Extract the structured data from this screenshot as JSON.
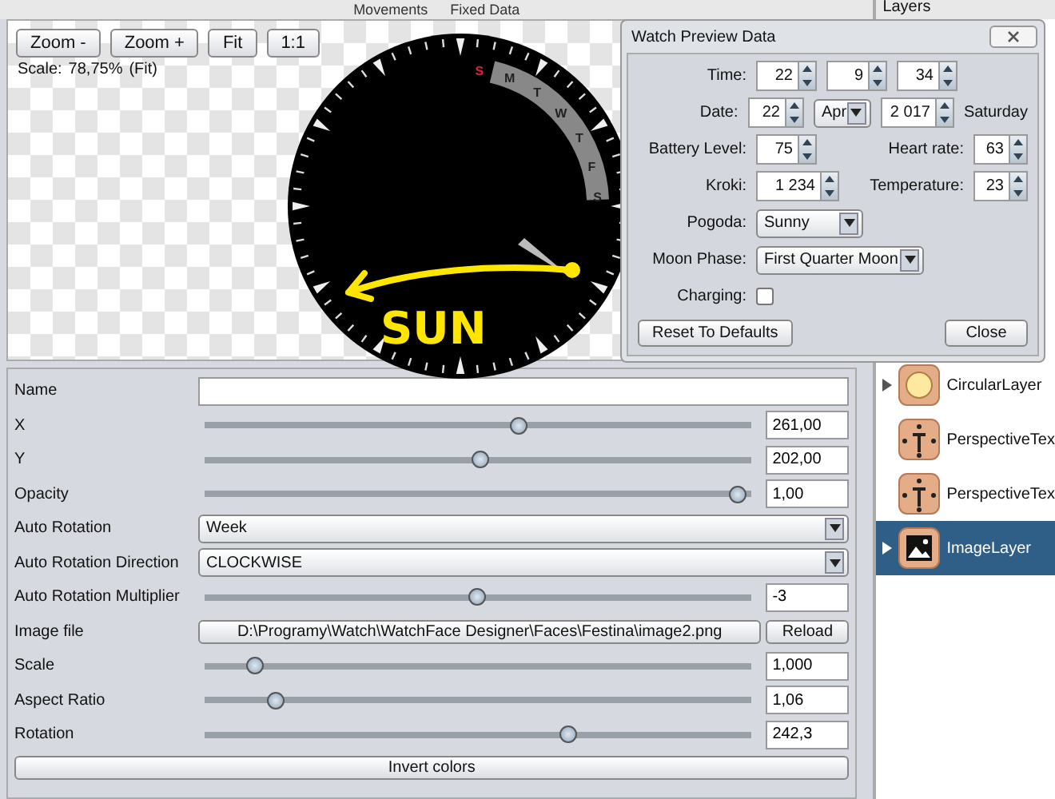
{
  "header": {
    "tabs": [
      "Movements",
      "Fixed Data"
    ]
  },
  "preview": {
    "buttons": [
      "Zoom -",
      "Zoom +",
      "Fit",
      "1:1"
    ],
    "scale_label": "Scale:",
    "scale_value": "78,75%",
    "scale_mode": "(Fit)",
    "dial_days": [
      "S",
      "M",
      "T",
      "W",
      "T",
      "F",
      "S"
    ],
    "annotation": "SUN"
  },
  "properties": [
    {
      "kind": "text",
      "label": "Name"
    },
    {
      "kind": "slider",
      "label": "X",
      "level": 0.577,
      "value": "261,00"
    },
    {
      "kind": "slider",
      "label": "Y",
      "level": 0.505,
      "value": "202,00"
    },
    {
      "kind": "slider",
      "label": "Opacity",
      "level": 0.99,
      "value": "1,00"
    },
    {
      "kind": "select",
      "label": "Auto Rotation",
      "value": "Week"
    },
    {
      "kind": "select",
      "label": "Auto Rotation Direction",
      "value": "CLOCKWISE"
    },
    {
      "kind": "slider",
      "label": "Auto Rotation Multiplier",
      "level": 0.497,
      "value": "-3"
    },
    {
      "kind": "file",
      "label": "Image file",
      "value": "D:\\Programy\\Watch\\WatchFace Designer\\Faces\\Festina\\image2.png",
      "action": "Reload"
    },
    {
      "kind": "slider",
      "label": "Scale",
      "level": 0.079,
      "value": "1,000"
    },
    {
      "kind": "slider",
      "label": "Aspect Ratio",
      "level": 0.117,
      "value": "1,06"
    },
    {
      "kind": "slider",
      "label": "Rotation",
      "level": 0.67,
      "value": "242,3"
    }
  ],
  "invert_button": "Invert colors",
  "layers": {
    "title": "Layers",
    "items": [
      {
        "name": "CircularLayer",
        "kind": "circle",
        "expandable": true,
        "selected": false
      },
      {
        "name": "PerspectiveTex",
        "kind": "text",
        "expandable": false,
        "selected": false
      },
      {
        "name": "PerspectiveTex",
        "kind": "text",
        "expandable": false,
        "selected": false
      },
      {
        "name": "ImageLayer",
        "kind": "image",
        "expandable": true,
        "selected": true
      }
    ]
  },
  "dialog": {
    "title": "Watch Preview Data",
    "time_label": "Time:",
    "time": [
      "22",
      "9",
      "34"
    ],
    "date_label": "Date:",
    "day": "22",
    "month": "Apr",
    "year": "2 017",
    "weekday": "Saturday",
    "battery_label": "Battery Level:",
    "battery": "75",
    "heart_label": "Heart rate:",
    "heart": "63",
    "steps_label": "Kroki:",
    "steps": "1 234",
    "temp_label": "Temperature:",
    "temp": "23",
    "weather_label": "Pogoda:",
    "weather": "Sunny",
    "moon_label": "Moon Phase:",
    "moon": "First Quarter Moon",
    "charging_label": "Charging:",
    "charging": false,
    "reset": "Reset To Defaults",
    "close": "Close"
  }
}
